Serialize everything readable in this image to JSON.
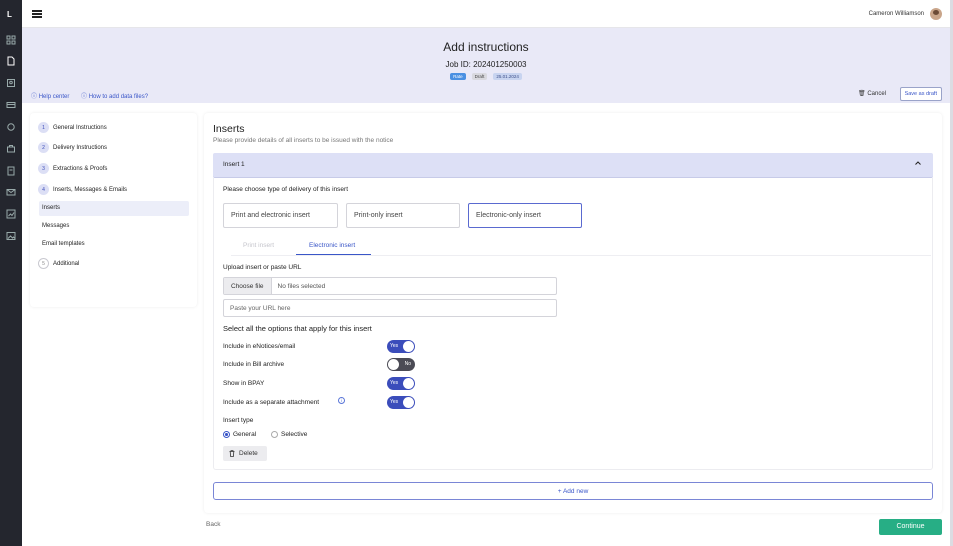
{
  "app": {
    "logo_letter": "L"
  },
  "user": {
    "name": "Cameron Williamson"
  },
  "header": {
    "title": "Add instructions",
    "job_id": "Job ID: 202401250003",
    "badges": [
      "Rate",
      "Draft",
      "25.01.2024"
    ],
    "help_center": "Help center",
    "how_to": "How to add data files?",
    "cancel": "Cancel",
    "save_draft": "Save as draft"
  },
  "steps": [
    {
      "num": "1",
      "label": "General Instructions"
    },
    {
      "num": "2",
      "label": "Delivery Instructions"
    },
    {
      "num": "3",
      "label": "Extractions & Proofs"
    },
    {
      "num": "4",
      "label": "Inserts, Messages & Emails"
    },
    {
      "num": "5",
      "label": "Additional"
    }
  ],
  "substeps": [
    "Inserts",
    "Messages",
    "Email templates"
  ],
  "main": {
    "title": "Inserts",
    "subtitle": "Please provide details of all inserts to be issued with the notice",
    "accordion_label": "Insert 1",
    "delivery_prompt": "Please choose type of delivery of this insert",
    "delivery_options": [
      "Print and electronic insert",
      "Print-only insert",
      "Electronic-only insert"
    ],
    "tabs": [
      "Print insert",
      "Electronic insert"
    ],
    "upload_label": "Upload insert or paste URL",
    "choose_file": "Choose file",
    "no_file": "No files selected",
    "url_placeholder": "Paste your URL here",
    "options_title": "Select all the options that apply for this insert",
    "options": [
      {
        "label": "Include in eNotices/email",
        "value": "Yes"
      },
      {
        "label": "Include in Bill archive",
        "value": "No"
      },
      {
        "label": "Show in BPAY",
        "value": "Yes"
      },
      {
        "label": "Include as a separate attachment",
        "value": "Yes"
      }
    ],
    "info_icon": "i",
    "insert_type_label": "Insert type",
    "insert_types": [
      "General",
      "Selective"
    ],
    "delete": "Delete",
    "add_new": "+ Add new"
  },
  "footer": {
    "back": "Back",
    "continue": "Continue"
  }
}
